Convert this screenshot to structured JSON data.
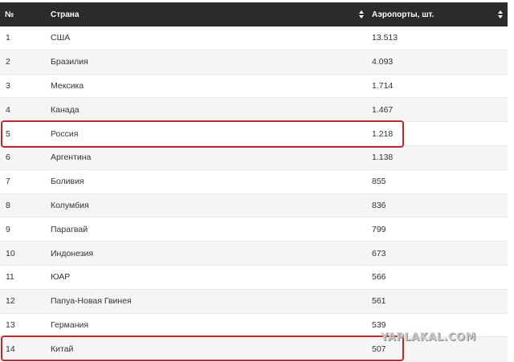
{
  "header": {
    "num": "№",
    "country": "Страна",
    "airports": "Аэропорты, шт."
  },
  "rows": [
    {
      "num": "1",
      "country": "США",
      "airports": "13.513"
    },
    {
      "num": "2",
      "country": "Бразилия",
      "airports": "4.093"
    },
    {
      "num": "3",
      "country": "Мексика",
      "airports": "1.714"
    },
    {
      "num": "4",
      "country": "Канада",
      "airports": "1.467"
    },
    {
      "num": "5",
      "country": "Россия",
      "airports": "1.218"
    },
    {
      "num": "6",
      "country": "Аргентина",
      "airports": "1.138"
    },
    {
      "num": "7",
      "country": "Боливия",
      "airports": "855"
    },
    {
      "num": "8",
      "country": "Колумбия",
      "airports": "836"
    },
    {
      "num": "9",
      "country": "Парагвай",
      "airports": "799"
    },
    {
      "num": "10",
      "country": "Индонезия",
      "airports": "673"
    },
    {
      "num": "11",
      "country": "ЮАР",
      "airports": "566"
    },
    {
      "num": "12",
      "country": "Папуа-Новая Гвинея",
      "airports": "561"
    },
    {
      "num": "13",
      "country": "Германия",
      "airports": "539"
    },
    {
      "num": "14",
      "country": "Китай",
      "airports": "507"
    }
  ],
  "highlight_color": "#c0272d",
  "header_color": "#2b2b2b",
  "watermark": "YAPLAKAL.COM"
}
